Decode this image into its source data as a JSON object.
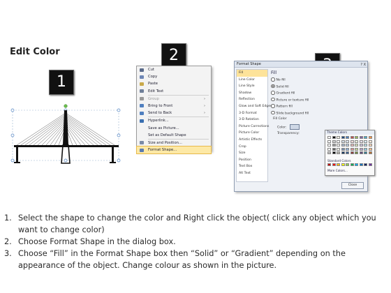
{
  "title": "Edit Color",
  "step_badges": [
    "1",
    "2",
    "3"
  ],
  "context_menu": {
    "items": [
      {
        "label": "Cut",
        "icon": "scissors-icon",
        "icon_color": "#5a6a8a"
      },
      {
        "label": "Copy",
        "icon": "copy-icon",
        "icon_color": "#6d86b5"
      },
      {
        "label": "Paste",
        "icon": "paste-icon",
        "icon_color": "#c9a94a"
      },
      {
        "label": "Edit Text",
        "icon": "edit-text-icon",
        "icon_color": "#6f7f99"
      },
      {
        "label": "Group",
        "icon": "group-icon",
        "icon_color": "#999999",
        "disabled": true,
        "submenu": true
      },
      {
        "label": "Bring to Front",
        "icon": "bring-front-icon",
        "icon_color": "#4f7fbf",
        "submenu": true
      },
      {
        "label": "Send to Back",
        "icon": "send-back-icon",
        "icon_color": "#4f7fbf",
        "submenu": true
      },
      {
        "label": "Hyperlink...",
        "icon": "hyperlink-icon",
        "icon_color": "#3a6fb0"
      },
      {
        "label": "Save as Picture...",
        "icon": "",
        "icon_color": ""
      },
      {
        "label": "Set as Default Shape",
        "icon": "",
        "icon_color": ""
      },
      {
        "label": "Size and Position...",
        "icon": "size-position-icon",
        "icon_color": "#7a8aa6"
      },
      {
        "label": "Format Shape...",
        "icon": "format-shape-icon",
        "icon_color": "#5b7bb0",
        "highlight": true
      }
    ]
  },
  "dialog": {
    "title": "Format Shape",
    "title_buttons": "? X",
    "nav_items": [
      "Fill",
      "Line Color",
      "Line Style",
      "Shadow",
      "Reflection",
      "Glow and Soft Edges",
      "3-D Format",
      "3-D Rotation",
      "Picture Corrections",
      "Picture Color",
      "Artistic Effects",
      "Crop",
      "Size",
      "Position",
      "Text Box",
      "Alt Text"
    ],
    "active_nav": "Fill",
    "fill_heading": "Fill",
    "fill_options": [
      {
        "label": "No fill",
        "selected": false
      },
      {
        "label": "Solid fill",
        "selected": true
      },
      {
        "label": "Gradient fill",
        "selected": false
      },
      {
        "label": "Picture or texture fill",
        "selected": false
      },
      {
        "label": "Pattern fill",
        "selected": false
      },
      {
        "label": "Slide background fill",
        "selected": false
      }
    ],
    "fill_color_group": "Fill Color",
    "color_label": "Color:",
    "transparency_label": "Transparency:",
    "close_label": "Close",
    "palette": {
      "theme_label": "Theme Colors",
      "standard_label": "Standard Colors",
      "more_label": "More Colors...",
      "theme_top": [
        "#ffffff",
        "#000000",
        "#eeece1",
        "#1f497d",
        "#4f81bd",
        "#c0504d",
        "#9bbb59",
        "#8064a2",
        "#4bacc6",
        "#f79646"
      ],
      "standard": [
        "#c00000",
        "#ff0000",
        "#ffc000",
        "#ffff00",
        "#92d050",
        "#00b050",
        "#00b0f0",
        "#0070c0",
        "#002060",
        "#7030a0"
      ]
    }
  },
  "instructions": [
    {
      "num": "1.",
      "text": "Select the shape to change the color and Right click the object( click any object which you want to change color)"
    },
    {
      "num": "2.",
      "text": "Choose Format Shape in the dialog box."
    },
    {
      "num": "3.",
      "text": "Choose “Fill” in the Format Shape box then “Solid” or “Gradient” depending on the appearance of the object. Change colour as shown in the picture."
    }
  ]
}
